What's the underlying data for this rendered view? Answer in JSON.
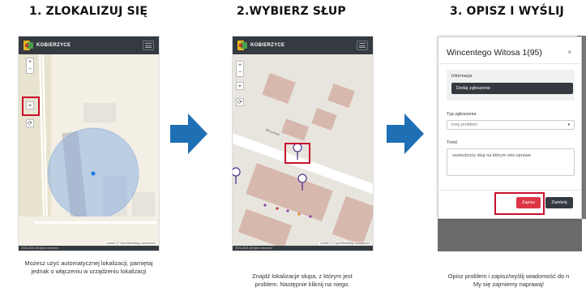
{
  "steps": [
    {
      "title": "1. ZLOKALIZUJ SIĘ",
      "caption_line1": "Możesz użyć automatycznej lokalizacji, pamiętaj",
      "caption_line2": "jednak o włączeniu w urządzeniu lokalizacji"
    },
    {
      "title": "2.WYBIERZ SŁUP",
      "caption_line1": "Znajdź lokalizacje słupa, z którym jest",
      "caption_line2": "problem. Następnie kliknij na niego."
    },
    {
      "title": "3. OPISZ I WYŚLIJ",
      "caption_line1": "Opisz problem i zapisz/wyślij wiadomość do n",
      "caption_line2": "My się zajmiemy naprawą!"
    }
  ],
  "app": {
    "brand": "KOBIERZYCE",
    "zoom_in": "+",
    "zoom_out": "−",
    "attribution": "2020-2021 All rights reserved",
    "map_attribution": "Leaflet | © OpenStreetMap contributors",
    "street_label": "Wincentego"
  },
  "modal": {
    "title": "Wincentego Witosa 1(95)",
    "close": "×",
    "info_label": "Informacje",
    "add_report_button": "Dodaj zgłoszenie",
    "type_label": "Typ zgłoszenia",
    "type_value": "Inny problem",
    "content_label": "Treść",
    "content_value": "uszkodzony słup na którym wisi oprawa",
    "save_button": "Zapisz",
    "close_button": "Zamknij"
  },
  "colors": {
    "header": "#343a40",
    "highlight": "#c8102e",
    "arrow": "#1f6fb5",
    "save": "#dc3545"
  }
}
